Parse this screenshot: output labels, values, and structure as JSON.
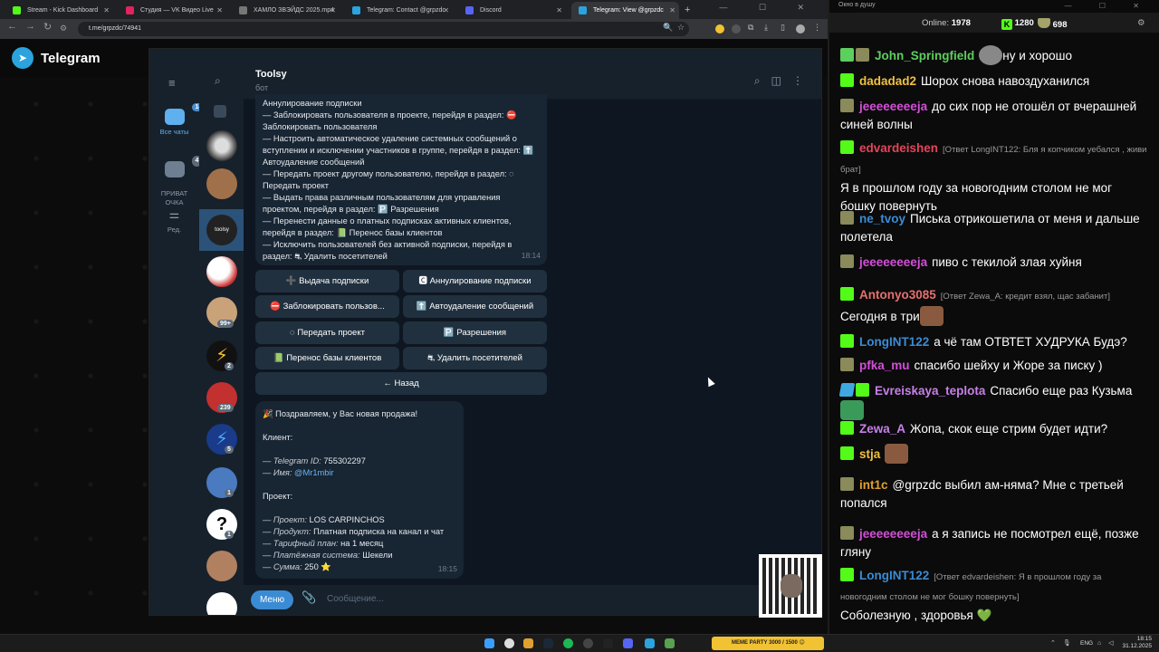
{
  "browser": {
    "tabs": [
      {
        "title": "Stream - Kick Dashboard",
        "color": "#53fc18"
      },
      {
        "title": "Студия — VK Видео Live",
        "color": "#e0245e"
      },
      {
        "title": "ХАМЛО ЗВЭЙДС 2025.mp4",
        "color": "#777777"
      },
      {
        "title": "Telegram: Contact @grpzdc",
        "color": "#2aa3de"
      },
      {
        "title": "Discord",
        "color": "#5865f2"
      },
      {
        "title": "Telegram: View @grpzdc",
        "color": "#2aa3de"
      }
    ],
    "new_tab": "+",
    "url": "t.me/grpzdc/74941"
  },
  "telegram": {
    "brand": "Telegram",
    "folders": [
      {
        "label": "Все чаты",
        "badge": "14"
      },
      {
        "label": "ПРИВАТ\nОЧКА",
        "badge": "4"
      },
      {
        "label": "Ред.",
        "badge": ""
      }
    ],
    "chat_badges": [
      "99+",
      "2",
      "239",
      "5",
      "1",
      "1"
    ],
    "selected_avatar": "toolsy",
    "chat": {
      "name": "Toolsy",
      "status": "бот",
      "message1": {
        "text": "Аннулирование подписки\n— Заблокировать пользователя в проекте, перейдя в раздел: ⛔ Заблокировать пользователя\n— Настроить автоматическое удаление системных сообщений о вступлении и исключении участников в группе, перейдя в раздел: ⬆️ Автоудаление сообщений\n— Передать проект другому пользователю, перейдя в раздел: ◌ Передать проект\n— Выдать права различным пользователям для управления проектом, перейдя в раздел: 🅿️ Разрешения\n— Перенести данные о платных подписках активных клиентов, перейдя в раздел: 📗 Перенос базы клиентов\n— Исключить пользователей без активной подписки, перейдя в раздел: ⛐ Удалить посетителей",
        "time": "18:14"
      },
      "buttons": [
        "➕ Выдача подписки",
        "🅲 Аннулирование подписки",
        "⛔ Заблокировать пользов...",
        "⬆️ Автоудаление сообщений",
        "◌ Передать проект",
        "🅿️ Разрешения",
        "📗 Перенос базы клиентов",
        "⛐ Удалить посетителей",
        "← Назад"
      ],
      "message2": {
        "title": "🎉 Поздравляем, у Вас новая продажа!",
        "client_label": "Клиент:",
        "tg_id_label": "— Telegram ID:",
        "tg_id": "755302297",
        "name_label": "— Имя:",
        "name": "@Mr1mbir",
        "project_label": "Проект:",
        "proj_label": "— Проект:",
        "proj": "LOS CARPINCHOS",
        "product_label": "— Продукт:",
        "product": "Платная подписка на канал и чат",
        "plan_label": "— Тарифный план:",
        "plan": "на 1 месяц",
        "pay_label": "— Платёжная система:",
        "pay": "Шекели",
        "sum_label": "— Сумма:",
        "sum": "250 ⭐",
        "time": "18:15"
      },
      "menu_button": "Меню",
      "input_placeholder": "Сообщение..."
    }
  },
  "chat_panel": {
    "title": "Окно в душу",
    "online_label": "Online:",
    "online": "1978",
    "kick_count": "1280",
    "trophy_count": "698",
    "messages": [
      {
        "user": "John_Springfield",
        "color": "#5ccf5c",
        "badges": [
          "g",
          "t"
        ],
        "reply": "",
        "text": "ну и хорошо",
        "emote_before": true
      },
      {
        "user": "dadadad2",
        "color": "#f0c040",
        "badges": [
          "k"
        ],
        "reply": "",
        "text": "Шорох снова навоздуханился"
      },
      {
        "user": "jeeeeeeeeja",
        "color": "#d34fd8",
        "badges": [
          "t"
        ],
        "reply": "",
        "text": "до сих пор не отошёл от вчерашней синей волны"
      },
      {
        "user": "edvardeishen",
        "color": "#e2465a",
        "badges": [
          "k"
        ],
        "reply": "[Ответ LongINT122: Бля я копчиком уебался , живи брат]",
        "text": "Я в прошлом году за новогодним столом не мог бошку повернуть"
      },
      {
        "user": "ne_tvoy",
        "color": "#3b8bd4",
        "badges": [
          "t"
        ],
        "reply": "",
        "text": "Писька отрикошетила от меня и дальше полетела"
      },
      {
        "user": "jeeeeeeeeja",
        "color": "#d34fd8",
        "badges": [
          "t"
        ],
        "reply": "",
        "text": "пиво с текилой злая хуйня"
      },
      {
        "user": "Antonyo3085",
        "color": "#e76f6f",
        "badges": [
          "k"
        ],
        "reply": "[Ответ Zewa_A: кредит взял, щас забанит]",
        "text": "Сегодня в три"
      },
      {
        "user": "LongINT122",
        "color": "#3b8bd4",
        "badges": [
          "k"
        ],
        "reply": "",
        "text": "а чё там ОТВТЕТ ХУДРУКА Будэ?"
      },
      {
        "user": "pfka_mu",
        "color": "#d34fd8",
        "badges": [
          "t"
        ],
        "reply": "",
        "text": "спасибо шейху и Жоре за писку )"
      },
      {
        "user": "Evreiskaya_teplota",
        "color": "#c680e8",
        "badges": [
          "b",
          "k"
        ],
        "reply": "",
        "text": "Спасибо еще раз Кузьма"
      },
      {
        "user": "Zewa_A",
        "color": "#c680e8",
        "badges": [
          "k"
        ],
        "reply": "",
        "text": "Жопа, скок еще стрим будет идти?"
      },
      {
        "user": "stja",
        "color": "#f0c040",
        "badges": [
          "k"
        ],
        "reply": "",
        "text": ""
      },
      {
        "user": "int1c",
        "color": "#e0a030",
        "badges": [
          "t"
        ],
        "reply": "",
        "text": "@grpzdc выбил ам-няма? Мне с третьей попался"
      },
      {
        "user": "jeeeeeeeeja",
        "color": "#d34fd8",
        "badges": [
          "t"
        ],
        "reply": "",
        "text": "а я запись не посмотрел ещё, позже гляну"
      },
      {
        "user": "LongINT122",
        "color": "#3b8bd4",
        "badges": [
          "k"
        ],
        "reply": "[Ответ edvardeishen: Я в прошлом году за новогодним столом не мог бошку повернуть]",
        "text": "Соболезную , здоровья 💚"
      }
    ]
  },
  "taskbar": {
    "lang": "ENG",
    "time": "18:15",
    "date": "31.12.2025",
    "widget": "MEME PARTY 3000 / 1500 😊"
  }
}
